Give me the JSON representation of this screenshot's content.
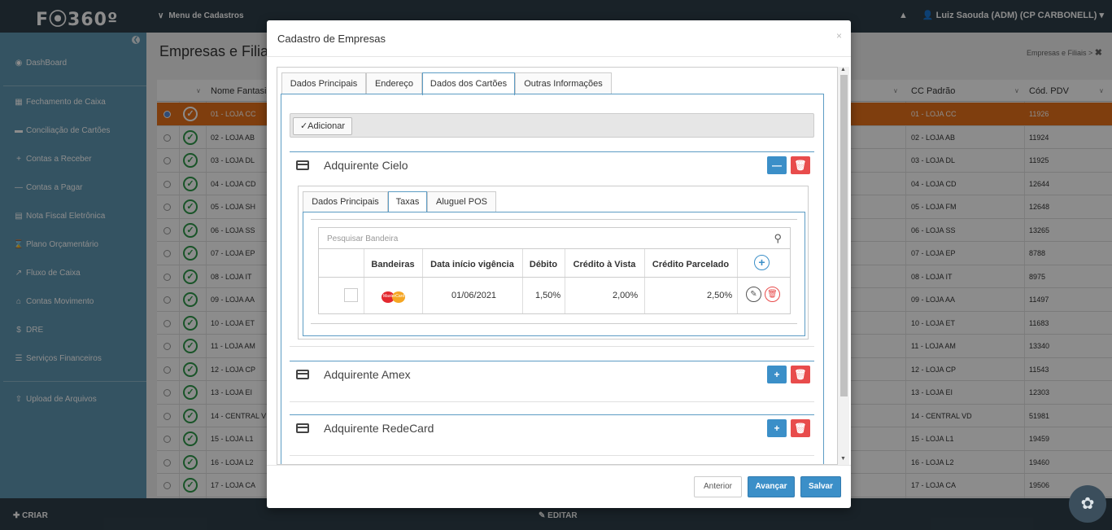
{
  "app": {
    "logo": "F⦿360º",
    "menu_label": "Menu de Cadastros",
    "user": "Luiz Saouda (ADM) (CP CARBONELL)"
  },
  "sidebar": {
    "items": [
      {
        "icon": "dashboard-icon",
        "label": "DashBoard"
      },
      {
        "icon": "calendar-icon",
        "label": "Fechamento de Caixa"
      },
      {
        "icon": "card-icon",
        "label": "Conciliação de Cartões"
      },
      {
        "icon": "plus-icon",
        "label": "Contas a Receber"
      },
      {
        "icon": "minus-icon",
        "label": "Contas a Pagar"
      },
      {
        "icon": "invoice-icon",
        "label": "Nota Fiscal Eletrônica"
      },
      {
        "icon": "hourglass-icon",
        "label": "Plano Orçamentário"
      },
      {
        "icon": "chart-icon",
        "label": "Fluxo de Caixa"
      },
      {
        "icon": "bank-icon",
        "label": "Contas Movimento"
      },
      {
        "icon": "dollar-icon",
        "label": "DRE"
      },
      {
        "icon": "list-icon",
        "label": "Serviços Financeiros"
      },
      {
        "icon": "upload-icon",
        "label": "Upload de Arquivos"
      }
    ]
  },
  "page": {
    "title": "Empresas e Filiais",
    "breadcrumb": "Empresas e Filiais"
  },
  "bg_table": {
    "headers": [
      "Nome Fantasia",
      "CC Padrão",
      "Cód. PDV"
    ],
    "rows": [
      {
        "name": "01 - LOJA CC",
        "cc": "01 - LOJA CC",
        "pdv": "11926"
      },
      {
        "name": "02 - LOJA AB",
        "cc": "02 - LOJA AB",
        "pdv": "11924"
      },
      {
        "name": "03 - LOJA DL",
        "cc": "03 - LOJA DL",
        "pdv": "11925"
      },
      {
        "name": "04 - LOJA CD",
        "cc": "04 - LOJA CD",
        "pdv": "12644"
      },
      {
        "name": "05 - LOJA SH",
        "cc": "05 - LOJA FM",
        "pdv": "12648"
      },
      {
        "name": "06 - LOJA SS",
        "cc": "06 - LOJA SS",
        "pdv": "13265"
      },
      {
        "name": "07 - LOJA EP",
        "cc": "07 - LOJA EP",
        "pdv": "8788"
      },
      {
        "name": "08 - LOJA IT",
        "cc": "08 - LOJA IT",
        "pdv": "8975"
      },
      {
        "name": "09 - LOJA AA",
        "cc": "09 - LOJA AA",
        "pdv": "11497"
      },
      {
        "name": "10 - LOJA ET",
        "cc": "10 - LOJA ET",
        "pdv": "11683"
      },
      {
        "name": "11 - LOJA AM",
        "cc": "11 - LOJA AM",
        "pdv": "13340"
      },
      {
        "name": "12 - LOJA CP",
        "cc": "12 - LOJA CP",
        "pdv": "11543"
      },
      {
        "name": "13 - LOJA EI",
        "cc": "13 - LOJA EI",
        "pdv": "12303"
      },
      {
        "name": "14 - CENTRAL V",
        "cc": "14 - CENTRAL VD",
        "pdv": "51981"
      },
      {
        "name": "15 - LOJA L1",
        "cc": "15 - LOJA L1",
        "pdv": "19459"
      },
      {
        "name": "16 - LOJA L2",
        "cc": "16 - LOJA L2",
        "pdv": "19460"
      },
      {
        "name": "17 - LOJA CA",
        "cc": "17 - LOJA CA",
        "pdv": "19506"
      }
    ]
  },
  "bottom": {
    "criar": "CRIAR",
    "editar": "EDITAR"
  },
  "modal": {
    "title": "Cadastro de Empresas",
    "close": "×",
    "tabs": [
      "Dados Principais",
      "Endereço",
      "Dados dos Cartões",
      "Outras Informações"
    ],
    "add_button": "✓Adicionar",
    "sections": [
      {
        "title": "Adquirente Cielo",
        "tabs": [
          "Dados Principais",
          "Taxas",
          "Aluguel POS"
        ],
        "search_placeholder": "Pesquisar Bandeira",
        "columns": [
          "Bandeiras",
          "Data início vigência",
          "Débito",
          "Crédito à Vista",
          "Crédito Parcelado"
        ],
        "rows": [
          {
            "brand_text": "MasterCard",
            "date": "01/06/2021",
            "debito": "1,50%",
            "vista": "2,00%",
            "parcelado": "2,50%"
          }
        ]
      },
      {
        "title": "Adquirente Amex"
      },
      {
        "title": "Adquirente RedeCard"
      }
    ],
    "buttons": {
      "anterior": "Anterior",
      "avancar": "Avançar",
      "salvar": "Salvar"
    }
  },
  "colors": {
    "topbar": "#2f3f4a",
    "sidebar": "#5f97b3",
    "selected_row": "#e8711a",
    "primary": "#3b8fc8",
    "danger": "#e84c4c",
    "success": "#2e9a4a"
  }
}
